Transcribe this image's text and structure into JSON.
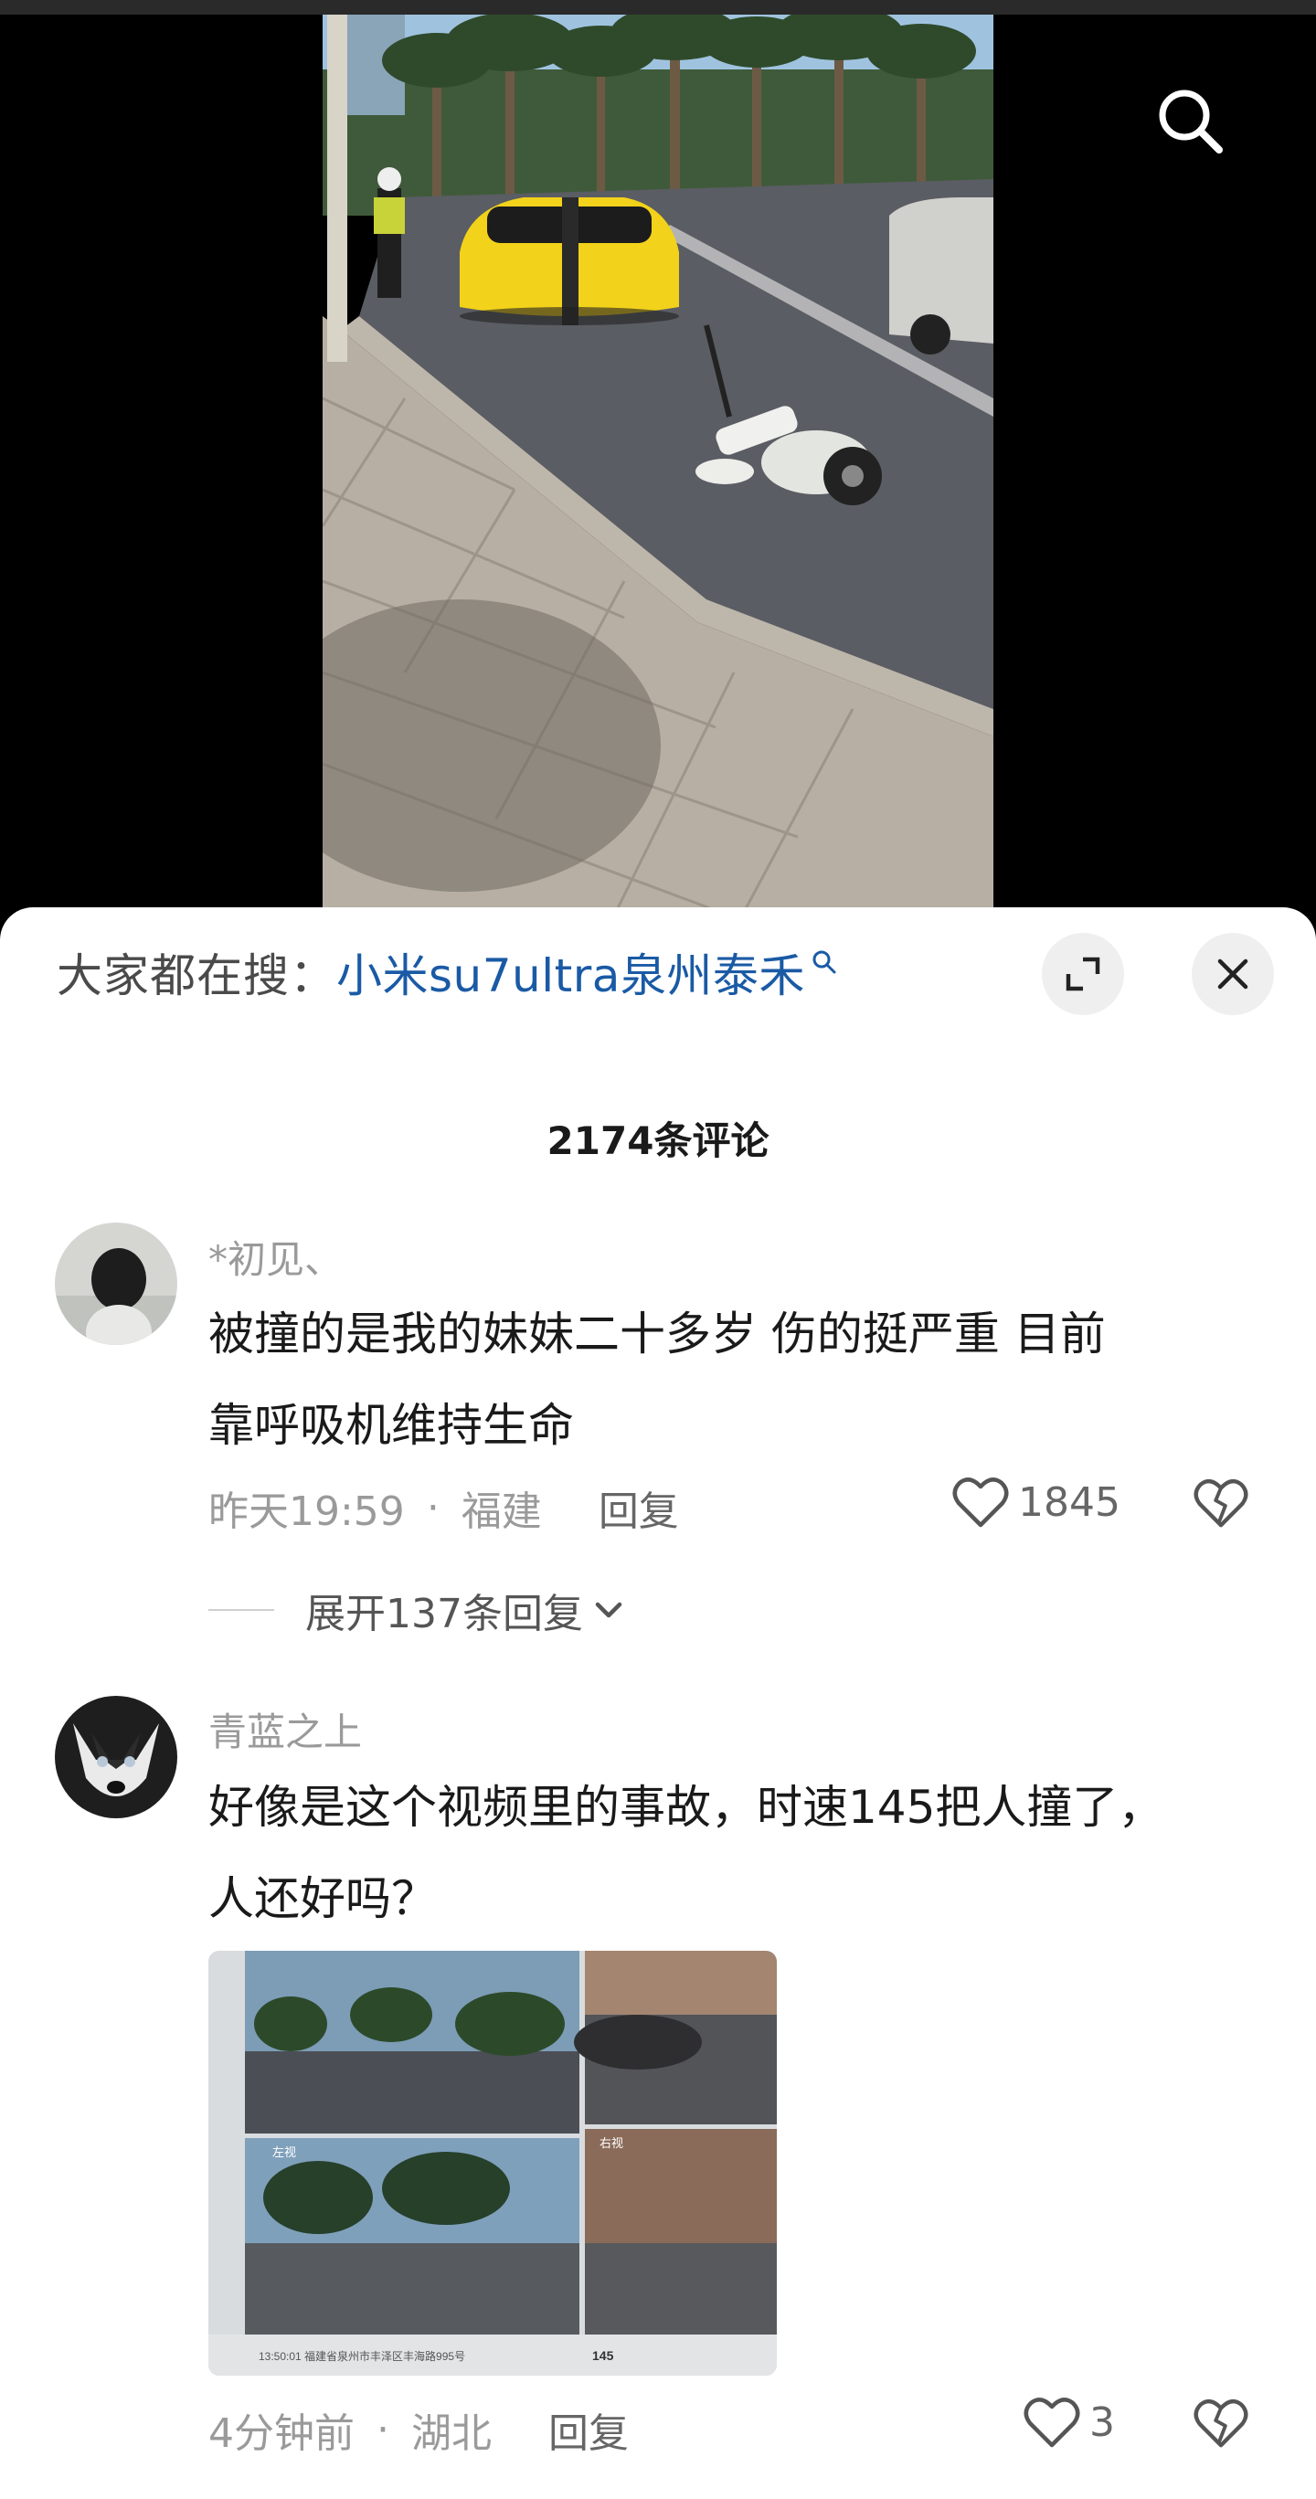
{
  "video": {
    "icons": {
      "search": "search-icon"
    }
  },
  "sheet": {
    "search_prefix": "大家都在搜：",
    "search_link": "小米su7ultra泉州泰禾",
    "icons": {
      "mini_search": "search-icon",
      "expand": "expand-icon",
      "close": "close-icon"
    },
    "comment_count": "2174条评论"
  },
  "comments": [
    {
      "username": "*初见、",
      "text_line1": "被撞的是我的妹妹二十多岁 伤的挺严重  目前",
      "text_line2": "靠呼吸机维持生命",
      "time": "昨天19:59",
      "dot": "·",
      "location": "福建",
      "reply_label": "回复",
      "likes": "1845",
      "expand_replies": "展开137条回复"
    },
    {
      "username": "青蓝之上",
      "text_line1": "好像是这个视频里的事故，时速145把人撞了，",
      "text_line2": "人还好吗？",
      "time": "4分钟前",
      "dot": "·",
      "location": "湖北",
      "reply_label": "回复",
      "likes": "3",
      "image_caption": "13:50:01 福建省泉州市丰泽区丰海路995号",
      "image_speed": "145",
      "image_label_left": "左视",
      "image_label_right": "右视"
    }
  ],
  "colors": {
    "link": "#1a5aa5",
    "muted": "#9a9a9a",
    "text": "#1a1a1a",
    "car_yellow": "#f2d21a"
  }
}
